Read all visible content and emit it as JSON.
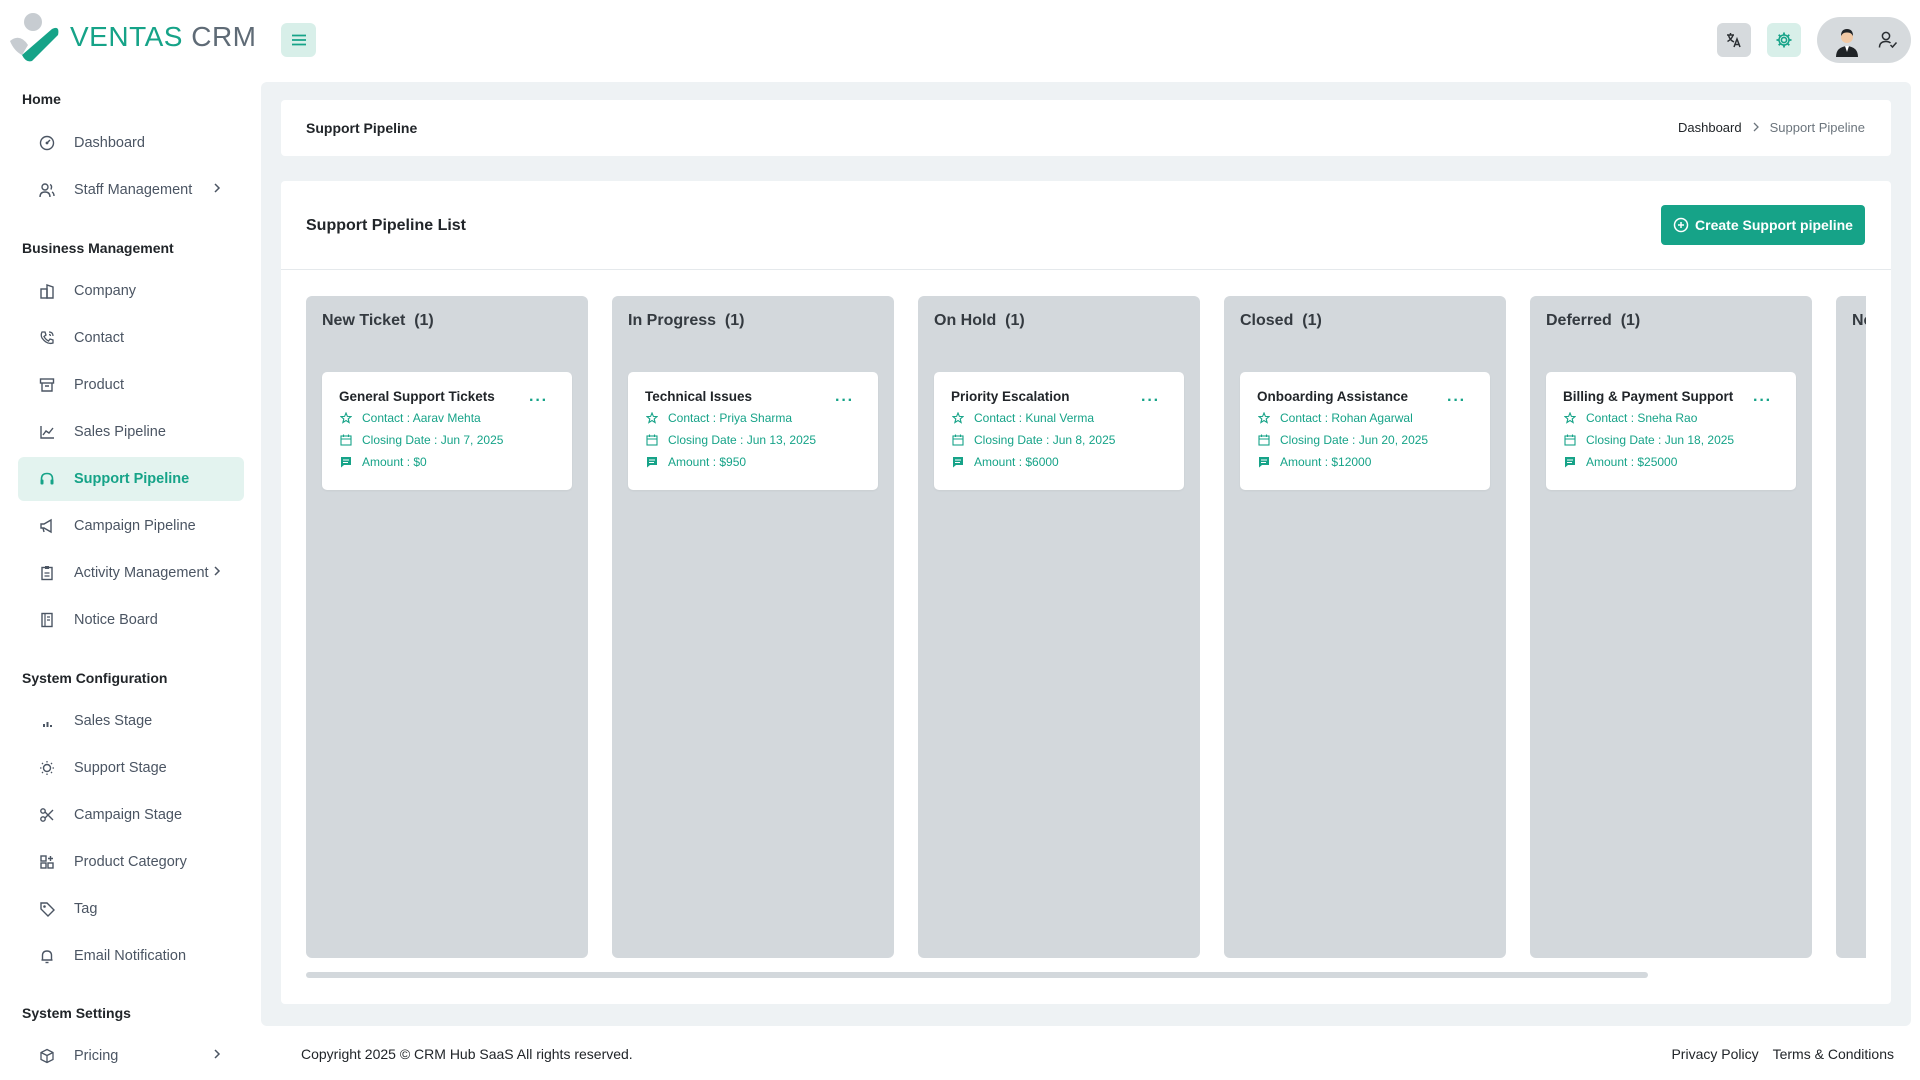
{
  "brand": {
    "name_a": "VENTAS",
    "name_b": "CRM"
  },
  "sidebar": {
    "sections": [
      {
        "title": "Home"
      },
      {
        "title": "Business Management"
      },
      {
        "title": "System Configuration"
      },
      {
        "title": "System Settings"
      }
    ],
    "items": [
      {
        "label": "Dashboard",
        "icon": "dashboard-icon"
      },
      {
        "label": "Staff Management",
        "icon": "users-icon"
      },
      {
        "label": "Company",
        "icon": "building-icon"
      },
      {
        "label": "Contact",
        "icon": "phone-icon"
      },
      {
        "label": "Product",
        "icon": "box-icon"
      },
      {
        "label": "Sales Pipeline",
        "icon": "chart-line-icon"
      },
      {
        "label": "Support Pipeline",
        "icon": "headset-icon"
      },
      {
        "label": "Campaign Pipeline",
        "icon": "megaphone-icon"
      },
      {
        "label": "Activity Management",
        "icon": "clipboard-icon"
      },
      {
        "label": "Notice Board",
        "icon": "notebook-icon"
      },
      {
        "label": "Sales Stage",
        "icon": "signal-icon"
      },
      {
        "label": "Support Stage",
        "icon": "bulb-icon"
      },
      {
        "label": "Campaign Stage",
        "icon": "scissors-icon"
      },
      {
        "label": "Product Category",
        "icon": "category-icon"
      },
      {
        "label": "Tag",
        "icon": "tag-icon"
      },
      {
        "label": "Email Notification",
        "icon": "bell-icon"
      },
      {
        "label": "Pricing",
        "icon": "package-icon"
      }
    ]
  },
  "page": {
    "title": "Support Pipeline"
  },
  "breadcrumb": {
    "root": "Dashboard",
    "current": "Support Pipeline"
  },
  "list": {
    "title": "Support Pipeline List",
    "create_label": "Create Support pipeline"
  },
  "columns": [
    {
      "name": "New Ticket",
      "count": "(1)",
      "card": {
        "title": "General Support Tickets",
        "contact": "Contact : Aarav Mehta",
        "closing": "Closing Date : Jun 7, 2025",
        "amount": "Amount : $0"
      }
    },
    {
      "name": "In Progress",
      "count": "(1)",
      "card": {
        "title": "Technical Issues",
        "contact": "Contact : Priya Sharma",
        "closing": "Closing Date : Jun 13, 2025",
        "amount": "Amount : $950"
      }
    },
    {
      "name": "On Hold",
      "count": "(1)",
      "card": {
        "title": "Priority Escalation",
        "contact": "Contact : Kunal Verma",
        "closing": "Closing Date : Jun 8, 2025",
        "amount": "Amount : $6000"
      }
    },
    {
      "name": "Closed",
      "count": "(1)",
      "card": {
        "title": "Onboarding Assistance",
        "contact": "Contact : Rohan Agarwal",
        "closing": "Closing Date : Jun 20, 2025",
        "amount": "Amount : $12000"
      }
    },
    {
      "name": "Deferred",
      "count": "(1)",
      "card": {
        "title": "Billing & Payment Support",
        "contact": "Contact : Sneha Rao",
        "closing": "Closing Date : Jun 18, 2025",
        "amount": "Amount : $25000"
      }
    },
    {
      "name": "Ne"
    }
  ],
  "footer": {
    "copyright": "Copyright 2025 © CRM Hub SaaS All rights reserved.",
    "privacy": "Privacy Policy",
    "terms": "Terms & Conditions"
  },
  "colors": {
    "accent": "#16a388",
    "column_bg": "#d3d8dc",
    "main_bg": "#eef2f4"
  }
}
